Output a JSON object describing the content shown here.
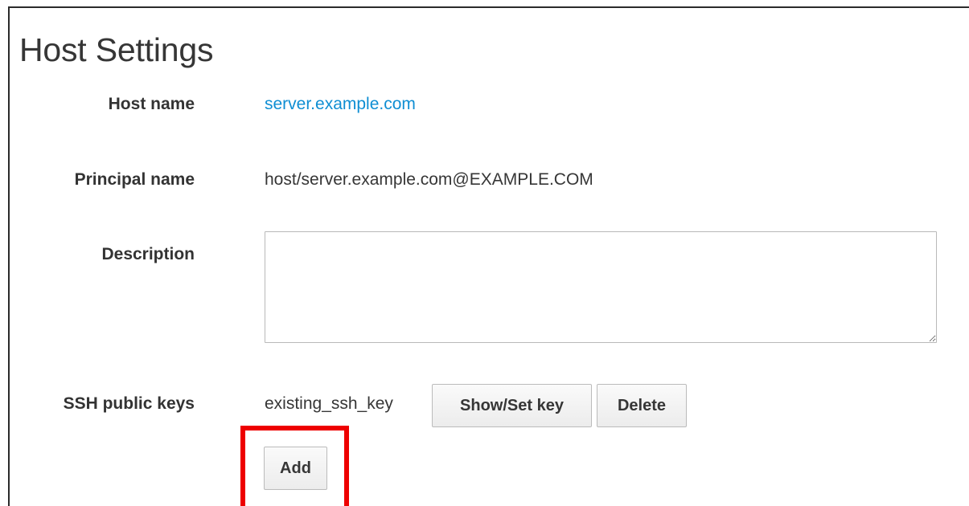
{
  "page": {
    "title": "Host Settings"
  },
  "fields": {
    "host_name": {
      "label": "Host name",
      "value": "server.example.com"
    },
    "principal_name": {
      "label": "Principal name",
      "value": "host/server.example.com@EXAMPLE.COM"
    },
    "description": {
      "label": "Description",
      "value": "",
      "placeholder": ""
    },
    "ssh_public_keys": {
      "label": "SSH public keys",
      "keys": [
        {
          "name": "existing_ssh_key",
          "show_set_label": "Show/Set key",
          "delete_label": "Delete"
        }
      ],
      "add_label": "Add"
    }
  },
  "colors": {
    "link": "#0e8ed3",
    "highlight": "#ee0000"
  }
}
